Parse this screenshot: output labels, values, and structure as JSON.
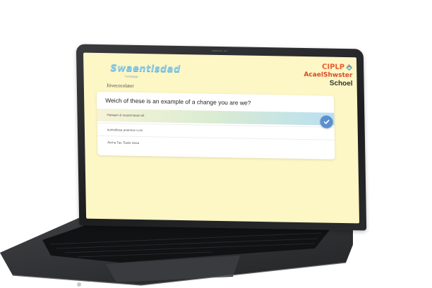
{
  "screen": {
    "camera_label": "macbook pro",
    "header": {
      "logo_title": "Swaentisdad",
      "logo_subtitle": "Turnbridge",
      "badge_text": "CIPLP",
      "brand_name": "AcaelShwster",
      "school_name": "Schoel"
    },
    "breadcrumb": "Jiivecocolater",
    "quiz": {
      "question": "Weich of these is an example of a change you are we?",
      "options": [
        {
          "label": "Hawaen & reuamnasan.sit",
          "selected": true
        },
        {
          "label": "auinsdiosa anannus v.cin",
          "selected": false
        },
        {
          "label": "Aerna Tau Tiasie sissa",
          "selected": false
        }
      ]
    }
  },
  "colors": {
    "screen_bg": "#fdf6c5",
    "accent_blue": "#5b8fd0",
    "brand_orange": "#e85d2f"
  },
  "icons": {
    "check": "check-icon",
    "badge": "badge-icon"
  }
}
